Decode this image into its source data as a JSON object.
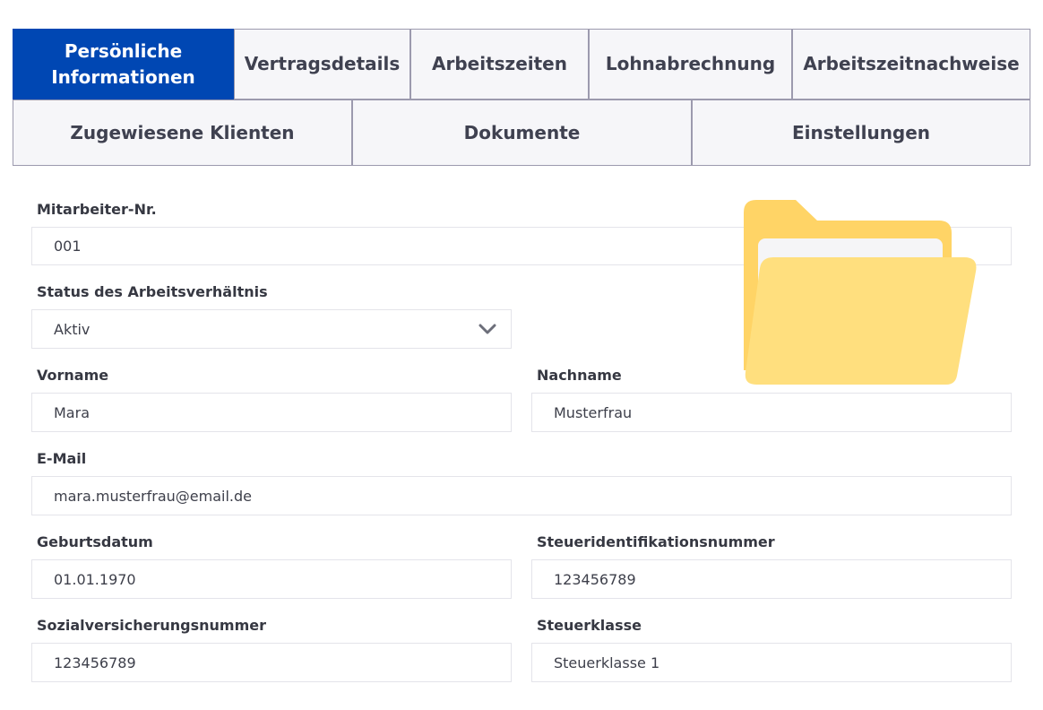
{
  "tabs_row1": [
    {
      "label": "Persönliche\nInformationen",
      "active": true
    },
    {
      "label": "Vertragsdetails",
      "active": false
    },
    {
      "label": "Arbeitszeiten",
      "active": false
    },
    {
      "label": "Lohnabrechnung",
      "active": false
    },
    {
      "label": "Arbeitszeitnachweise",
      "active": false
    }
  ],
  "tabs_row2": [
    {
      "label": "Zugewiesene Klienten"
    },
    {
      "label": "Dokumente"
    },
    {
      "label": "Einstellungen"
    }
  ],
  "form": {
    "employee_no": {
      "label": "Mitarbeiter-Nr.",
      "value": "001"
    },
    "employment_status": {
      "label": "Status des Arbeitsverhältnis",
      "value": "Aktiv"
    },
    "first_name": {
      "label": "Vorname",
      "value": "Mara"
    },
    "last_name": {
      "label": "Nachname",
      "value": "Musterfrau"
    },
    "email": {
      "label": "E-Mail",
      "value": "mara.musterfrau@email.de"
    },
    "birth_date": {
      "label": "Geburtsdatum",
      "value": "01.01.1970"
    },
    "tax_id": {
      "label": "Steueridentifikationsnummer",
      "value": "123456789"
    },
    "social_security_no": {
      "label": "Sozialversicherungsnummer",
      "value": "123456789"
    },
    "tax_class": {
      "label": "Steuerklasse",
      "value": "Steuerklasse 1"
    }
  },
  "icons": {
    "folder": "folder-open-icon",
    "dropdown": "chevron-down-icon"
  },
  "colors": {
    "active_tab": "#0047b3",
    "tab_background": "#f6f6f9",
    "tab_border": "#9c9aae",
    "folder_back": "#ffd466",
    "folder_front": "#ffdf7e",
    "folder_paper": "#f5f5f7"
  }
}
